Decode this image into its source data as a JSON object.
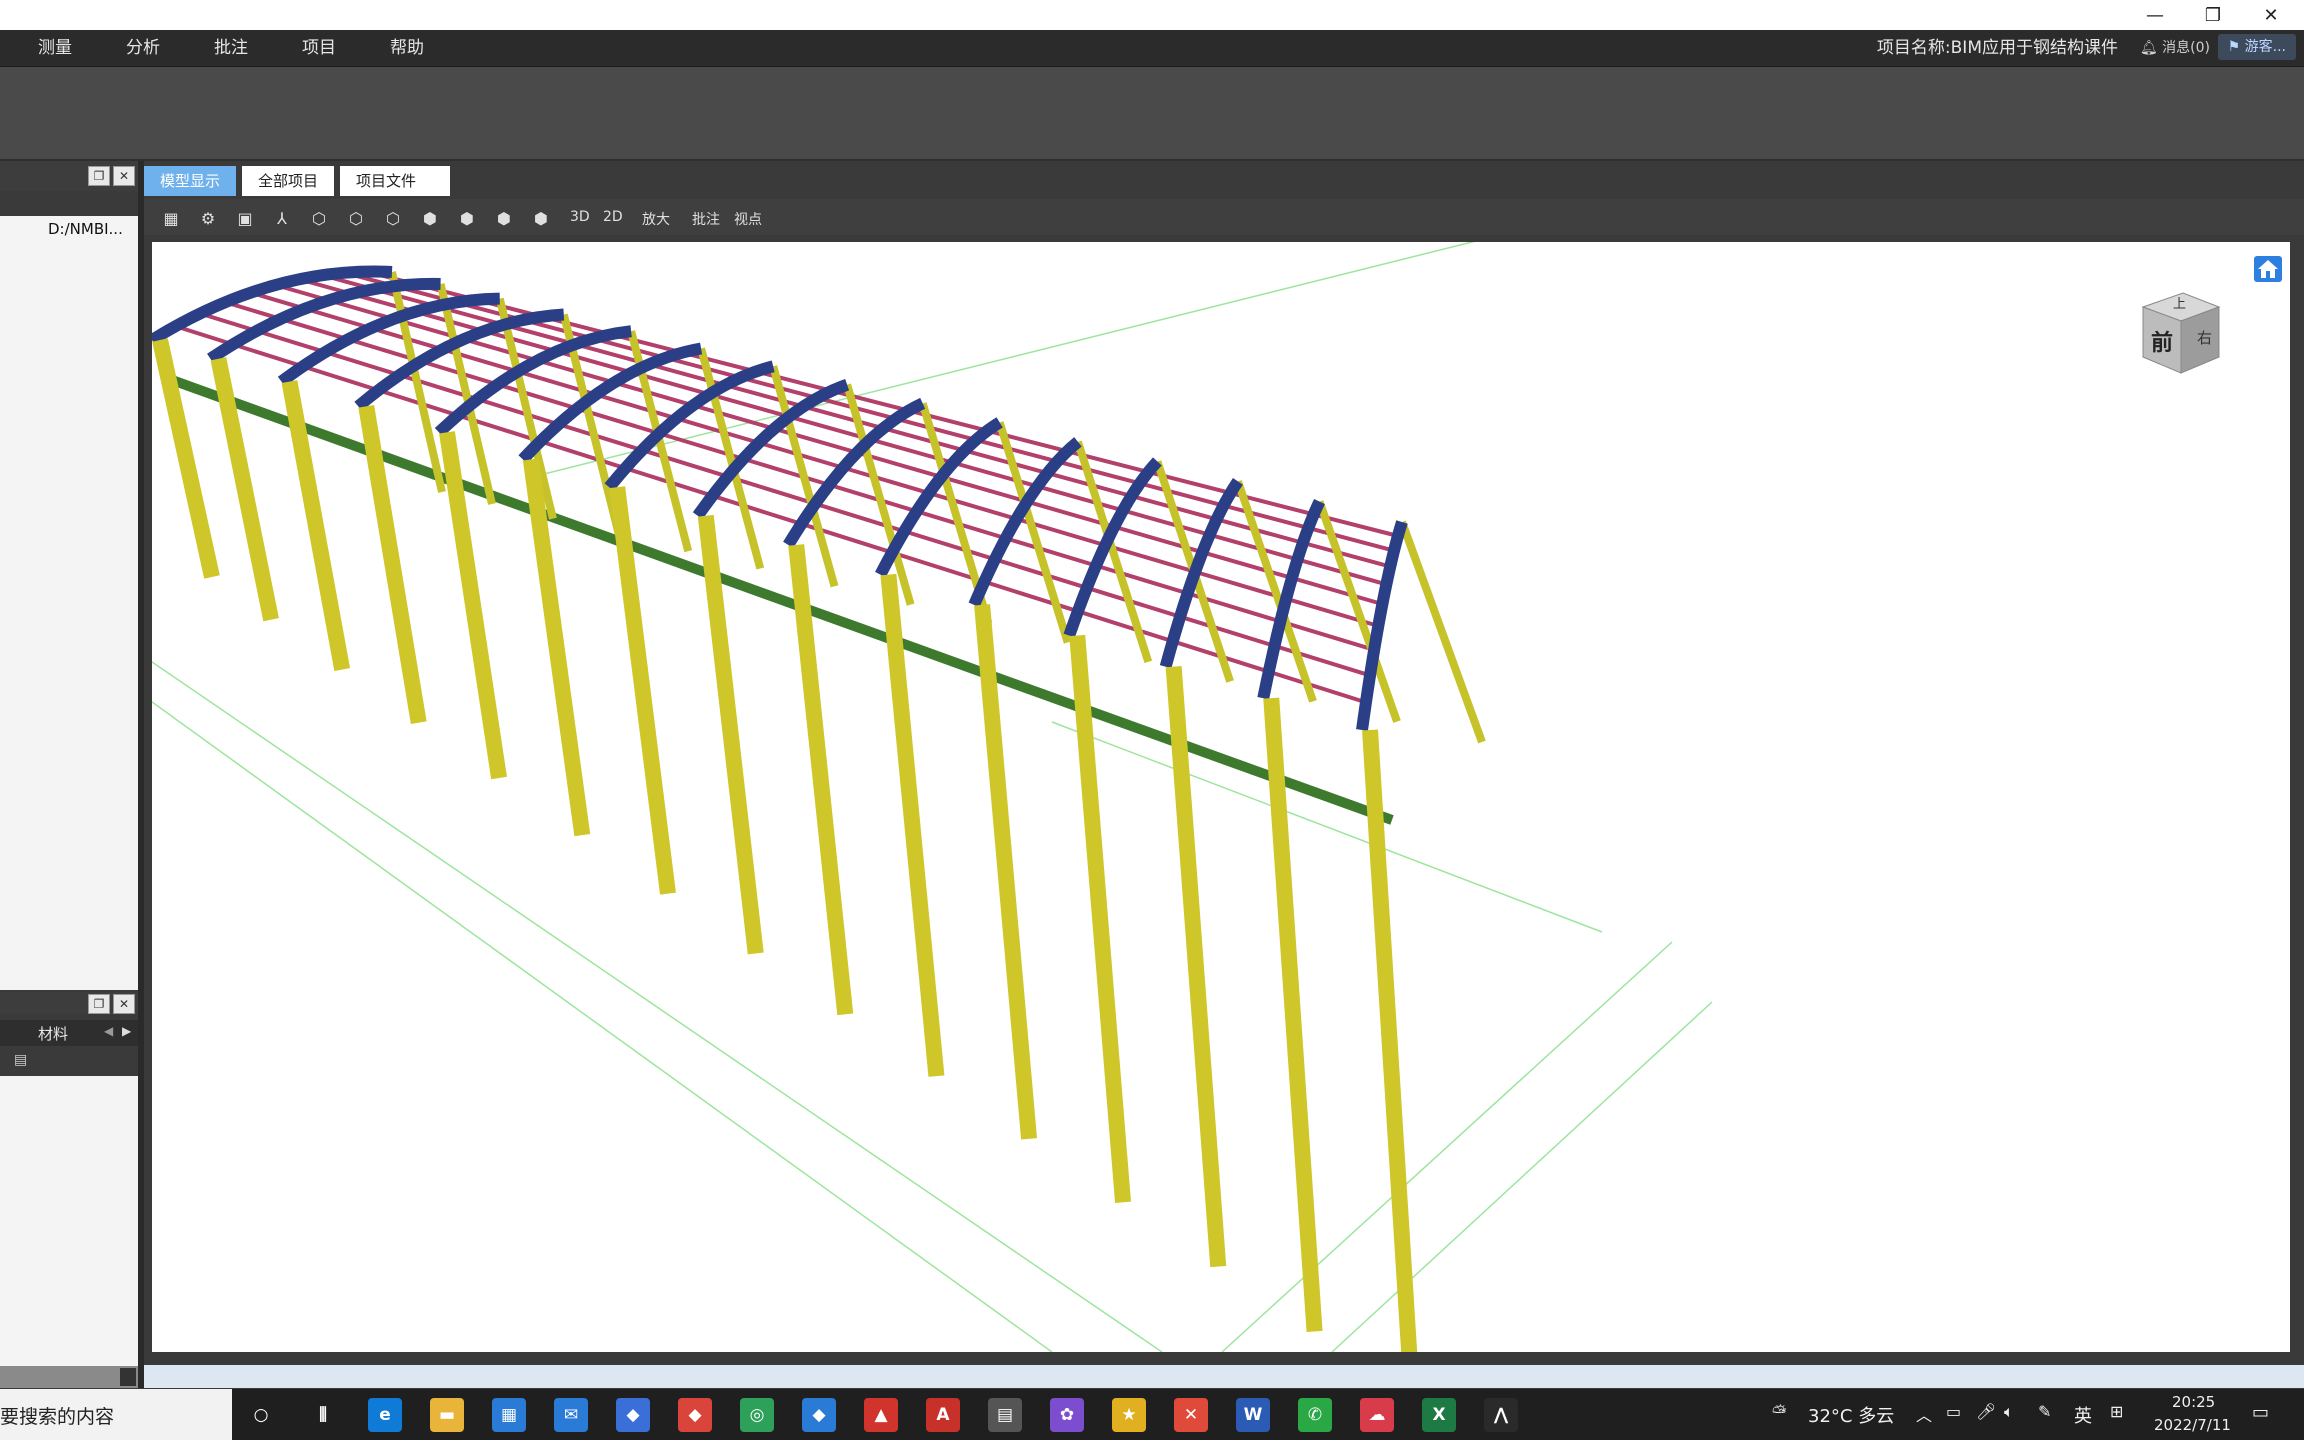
{
  "window": {
    "minimize_glyph": "—",
    "restore_glyph": "❐",
    "close_glyph": "✕"
  },
  "menu": {
    "items": [
      "测量",
      "分析",
      "批注",
      "项目",
      "帮助"
    ]
  },
  "header": {
    "project_name": "项目名称:BIM应用于钢结构课件",
    "messages": "消息(0)",
    "user": "游客..."
  },
  "left_panel": {
    "path": "D:/NMBI...",
    "float_glyph": "❐",
    "close_glyph": "✕",
    "materials_tab": "材料"
  },
  "tabs": [
    {
      "label": "模型显示",
      "active": true
    },
    {
      "label": "全部项目",
      "active": false
    },
    {
      "label": "项目文件",
      "active": false
    }
  ],
  "toolbar": {
    "icons": [
      "grid-icon",
      "settings-icon",
      "save-icon",
      "axis-icon",
      "box-add-icon",
      "box-icon",
      "box-check-icon",
      "group-icon",
      "solid-box-icon",
      "search-box-icon",
      "people-icon"
    ],
    "glyphs": [
      "▦",
      "⚙",
      "▣",
      "⅄",
      "⬡",
      "⬡",
      "⬡",
      "⬢",
      "⬢",
      "⬢",
      "⬢"
    ],
    "text_buttons": [
      "3D",
      "2D",
      "放大",
      "批注",
      "视点"
    ]
  },
  "viewcube": {
    "top": "上",
    "front": "前",
    "right": "右"
  },
  "taskbar": {
    "search_text": "要搜索的内容",
    "apps": [
      "cortana",
      "task-view",
      "edge",
      "file-explorer",
      "store",
      "mail",
      "app-blue",
      "app-red",
      "app-green",
      "app-maps",
      "app-sketch",
      "autocad",
      "app-database",
      "app-color",
      "app-star",
      "app-x",
      "word",
      "wechat",
      "app-cloud",
      "excel",
      "app-active"
    ],
    "app_glyphs": [
      "○",
      "⫼",
      "e",
      "▬",
      "▦",
      "✉",
      "◆",
      "◆",
      "◎",
      "◆",
      "▲",
      "A",
      "▤",
      "✿",
      "★",
      "✕",
      "W",
      "✆",
      "☁",
      "X",
      "⋀"
    ],
    "weather": "32°C 多云",
    "ime": "英",
    "time": "20:25",
    "date": "2022/7/11"
  }
}
